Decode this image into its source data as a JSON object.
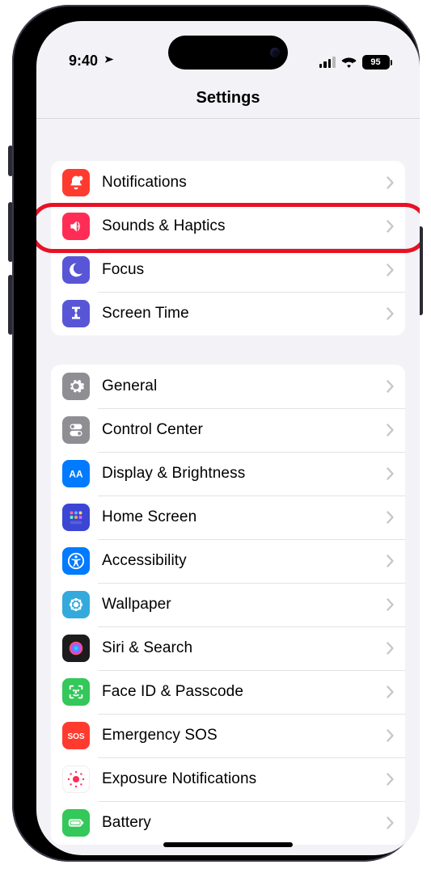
{
  "status": {
    "time": "9:40",
    "battery": "95"
  },
  "header": {
    "title": "Settings"
  },
  "groups": [
    {
      "rows": [
        {
          "id": "notifications",
          "label": "Notifications"
        },
        {
          "id": "sounds-haptics",
          "label": "Sounds & Haptics"
        },
        {
          "id": "focus",
          "label": "Focus",
          "highlighted": true
        },
        {
          "id": "screen-time",
          "label": "Screen Time"
        }
      ]
    },
    {
      "rows": [
        {
          "id": "general",
          "label": "General"
        },
        {
          "id": "control-center",
          "label": "Control Center"
        },
        {
          "id": "display-brightness",
          "label": "Display & Brightness"
        },
        {
          "id": "home-screen",
          "label": "Home Screen"
        },
        {
          "id": "accessibility",
          "label": "Accessibility"
        },
        {
          "id": "wallpaper",
          "label": "Wallpaper"
        },
        {
          "id": "siri-search",
          "label": "Siri & Search"
        },
        {
          "id": "face-id-passcode",
          "label": "Face ID & Passcode"
        },
        {
          "id": "emergency-sos",
          "label": "Emergency SOS"
        },
        {
          "id": "exposure-notifications",
          "label": "Exposure Notifications"
        },
        {
          "id": "battery",
          "label": "Battery"
        }
      ]
    }
  ]
}
